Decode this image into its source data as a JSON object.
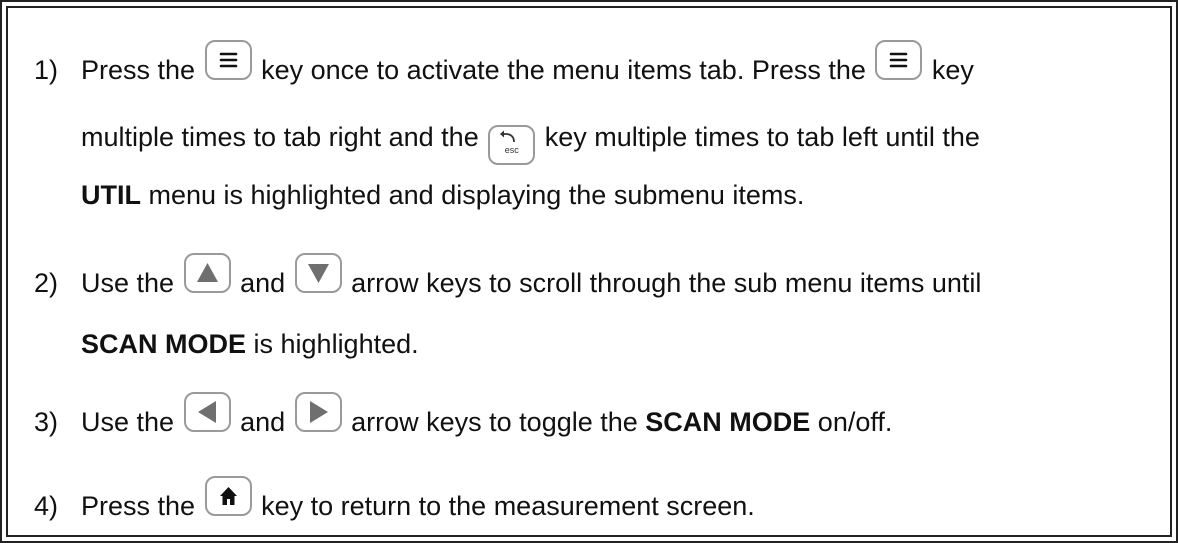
{
  "steps": [
    {
      "number": "1)",
      "line1": {
        "t1": "Press the ",
        "t2": " key once to activate the menu items tab.  Press the ",
        "t3": " key"
      },
      "line2": {
        "t1": "multiple times to tab right and the ",
        "t2": " key multiple times to tab left until the"
      },
      "line3": {
        "bold": "UTIL",
        "t1": " menu is highlighted and displaying the submenu items."
      }
    },
    {
      "number": "2)",
      "line1": {
        "t1": "Use the ",
        "t2": " and ",
        "t3": " arrow keys to scroll through the sub menu items until"
      },
      "line2": {
        "bold": "SCAN MODE",
        "t1": " is highlighted."
      }
    },
    {
      "number": "3)",
      "line1": {
        "t1": "Use the ",
        "t2": " and ",
        "t3": " arrow keys to toggle the ",
        "bold": "SCAN MODE",
        "t4": " on/off."
      }
    },
    {
      "number": "4)",
      "line1": {
        "t1": "Press the ",
        "t2": " key to return to the measurement screen."
      }
    }
  ],
  "keys": {
    "esc_label": "esc"
  }
}
